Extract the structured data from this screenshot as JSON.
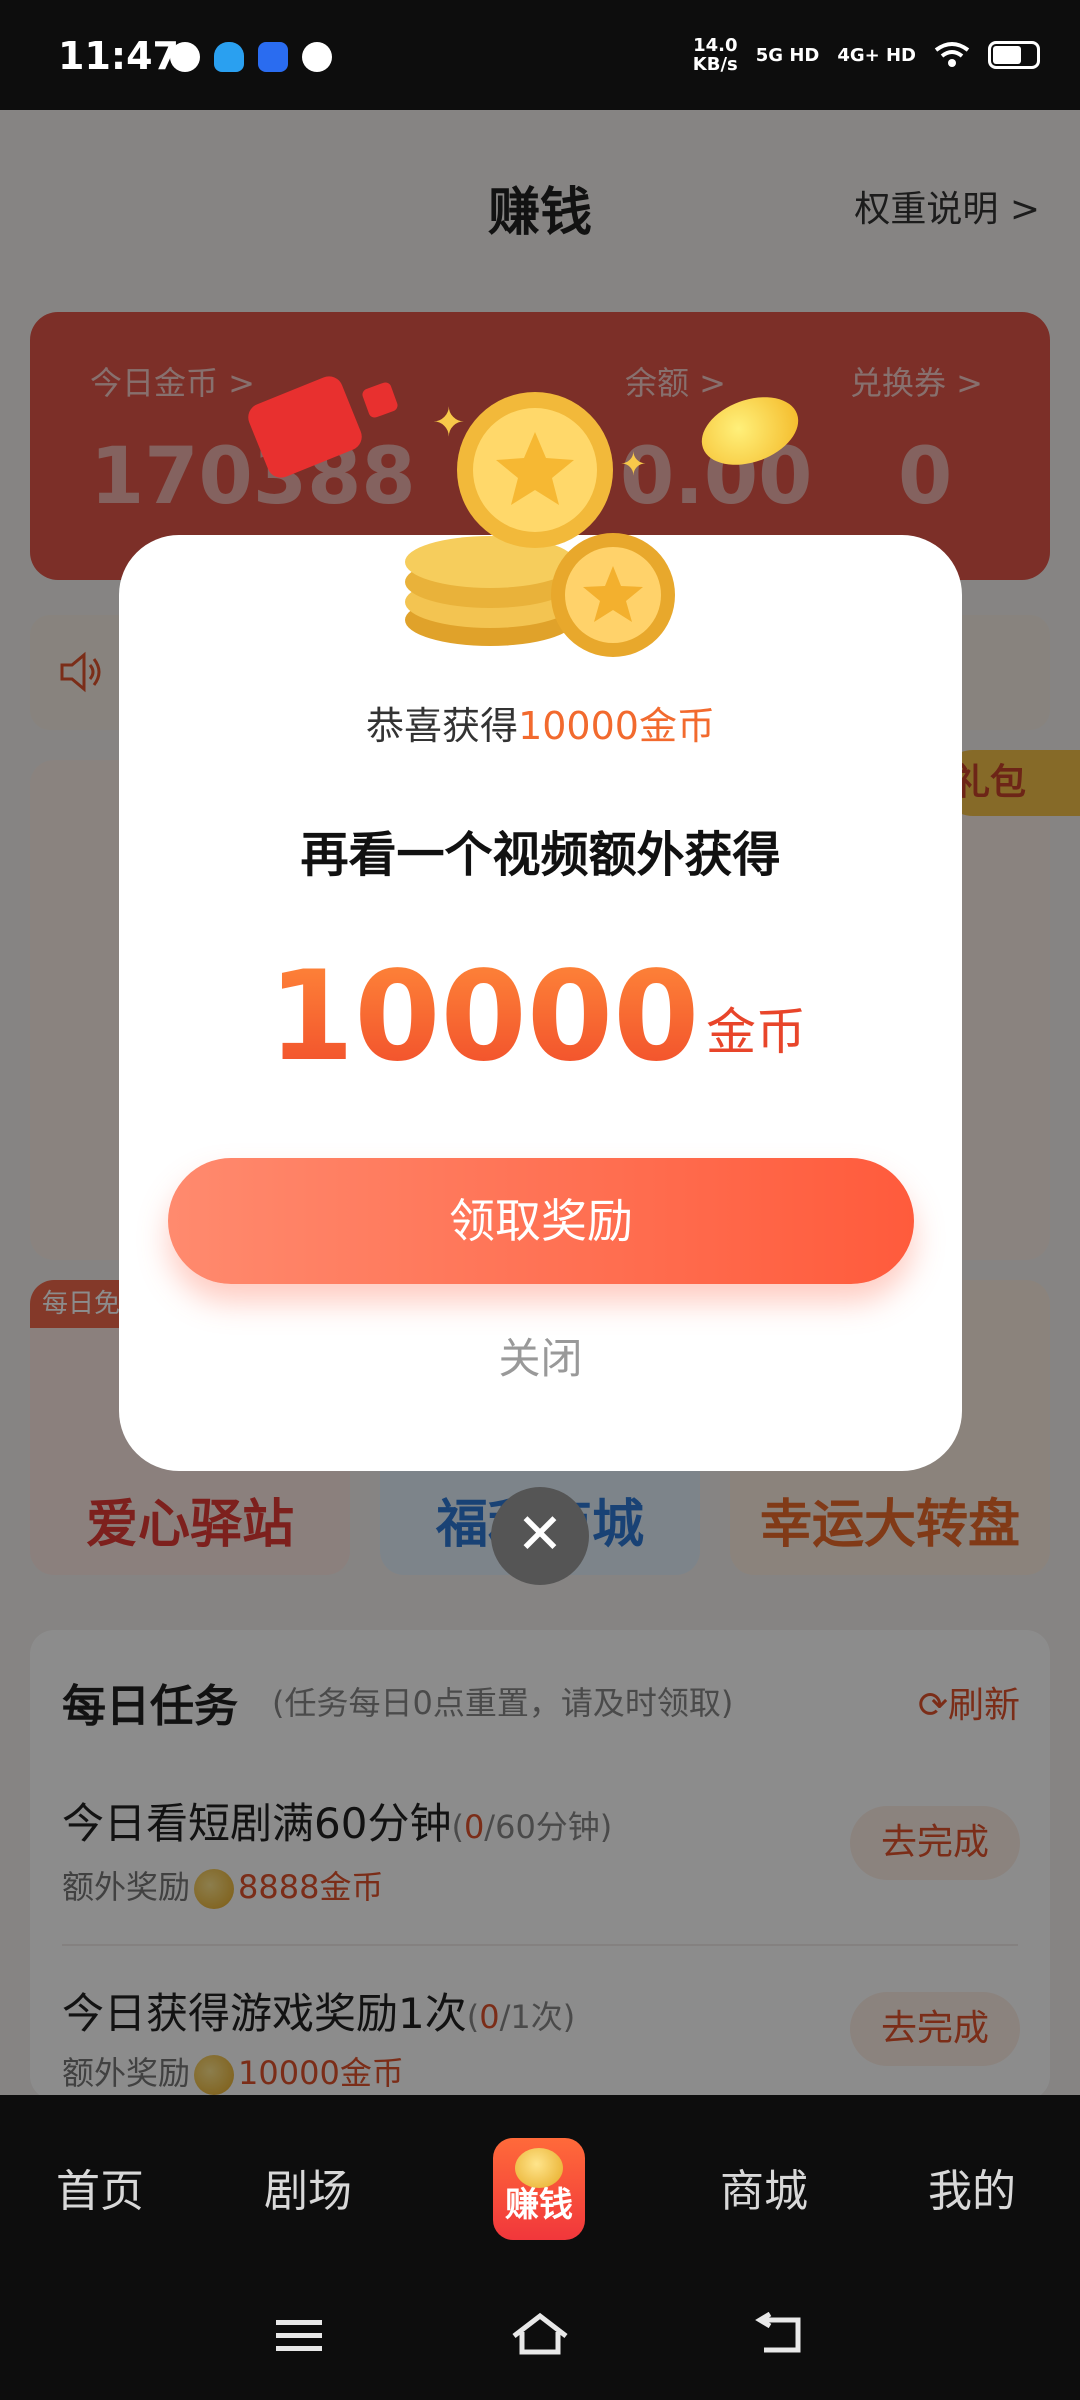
{
  "status_bar": {
    "time": "11:47",
    "speed_value": "14.0",
    "speed_unit": "KB/s",
    "net1": "5G HD",
    "net2": "4G+ HD"
  },
  "header": {
    "title": "赚钱",
    "rule_link": "权重说明 >"
  },
  "balance": {
    "today_coins_label": "今日金币 >",
    "today_coins_value": "170388",
    "balance_label": "余额 >",
    "balance_value": "0.00",
    "voucher_label": "兑换券 >",
    "voucher_value": "0"
  },
  "gift_badge": "礼包",
  "features": [
    {
      "label": "爱心驿站",
      "corner": "每日免"
    },
    {
      "label": "福利商城"
    },
    {
      "label": "幸运大转盘"
    }
  ],
  "tasks": {
    "title": "每日任务",
    "subtitle": "(任务每日0点重置，请及时领取)",
    "refresh": "刷新",
    "items": [
      {
        "title": "今日看短剧满60分钟",
        "progress_now": "0",
        "progress_total": "/60分钟)",
        "progress_open": "(",
        "reward_label": "额外奖励",
        "reward_amount": "8888金币",
        "button": "去完成"
      },
      {
        "title": "今日获得游戏奖励1次",
        "progress_now": "0",
        "progress_total": "/1次)",
        "progress_open": "(",
        "reward_label": "额外奖励",
        "reward_amount": "10000金币",
        "button": "去完成"
      }
    ]
  },
  "bottom_nav": {
    "home": "首页",
    "theater": "剧场",
    "earn": "赚钱",
    "mall": "商城",
    "mine": "我的"
  },
  "modal": {
    "congrats_prefix": "恭喜获得",
    "congrats_amount": "10000金币",
    "headline": "再看一个视频额外获得",
    "amount": "10000",
    "unit": "金币",
    "claim_button": "领取奖励",
    "close_text": "关闭",
    "close_x": "✕"
  }
}
